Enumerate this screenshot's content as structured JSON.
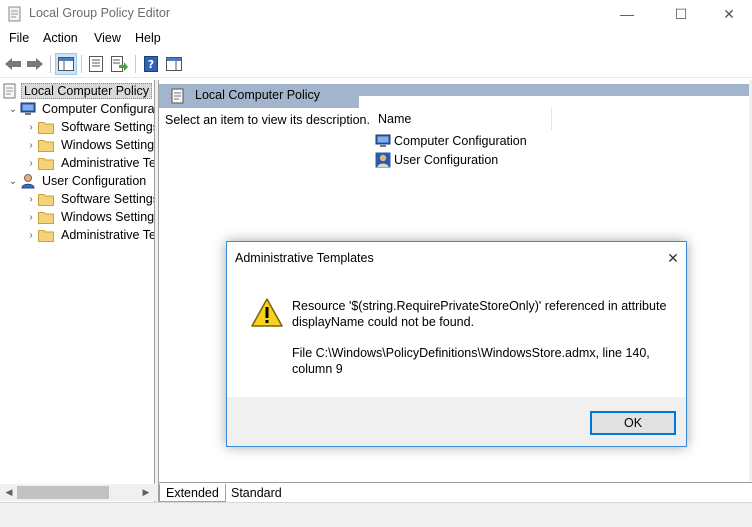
{
  "window": {
    "title": "Local Group Policy Editor",
    "controls": {
      "minimize": "—",
      "maximize": "☐",
      "close": "✕"
    }
  },
  "menu": {
    "items": [
      {
        "label": "File"
      },
      {
        "label": "Action"
      },
      {
        "label": "View"
      },
      {
        "label": "Help"
      }
    ]
  },
  "toolbar": {
    "buttons": [
      {
        "icon": "back-arrow-icon"
      },
      {
        "icon": "forward-arrow-icon"
      },
      {
        "icon": "show-hide-console-tree-icon"
      },
      {
        "icon": "properties-icon"
      },
      {
        "icon": "export-list-icon"
      },
      {
        "icon": "help-icon"
      },
      {
        "icon": "show-hide-action-pane-icon"
      }
    ]
  },
  "tree": {
    "items": [
      {
        "label": "Local Computer Policy",
        "expander": "",
        "icon": "policy-icon",
        "selected": true
      },
      {
        "label": "Computer Configura",
        "expander": "⌄",
        "icon": "computer-icon"
      },
      {
        "label": "Software Settings",
        "expander": "›",
        "icon": "folder-icon"
      },
      {
        "label": "Windows Setting",
        "expander": "›",
        "icon": "folder-icon"
      },
      {
        "label": "Administrative Te",
        "expander": "›",
        "icon": "folder-icon"
      },
      {
        "label": "User Configuration",
        "expander": "⌄",
        "icon": "user-icon"
      },
      {
        "label": "Software Settings",
        "expander": "›",
        "icon": "folder-icon"
      },
      {
        "label": "Windows Setting",
        "expander": "›",
        "icon": "folder-icon"
      },
      {
        "label": "Administrative Te",
        "expander": "›",
        "icon": "folder-icon"
      }
    ]
  },
  "details": {
    "header": "Local Computer Policy",
    "description": "Select an item to view its description.",
    "column_name": "Name",
    "rows": [
      {
        "label": "Computer Configuration",
        "icon": "computer-icon"
      },
      {
        "label": "User Configuration",
        "icon": "user-icon"
      }
    ]
  },
  "tabs": {
    "extended": "Extended",
    "standard": "Standard"
  },
  "scroll": {
    "left_arrow": "◀",
    "right_arrow": "▶"
  },
  "dialog": {
    "title": "Administrative Templates",
    "close": "✕",
    "message": "Resource '$(string.RequirePrivateStoreOnly)' referenced in attribute displayName could not be found.",
    "detail": "File C:\\Windows\\PolicyDefinitions\\WindowsStore.admx, line 140, column 9",
    "ok_label": "OK"
  }
}
